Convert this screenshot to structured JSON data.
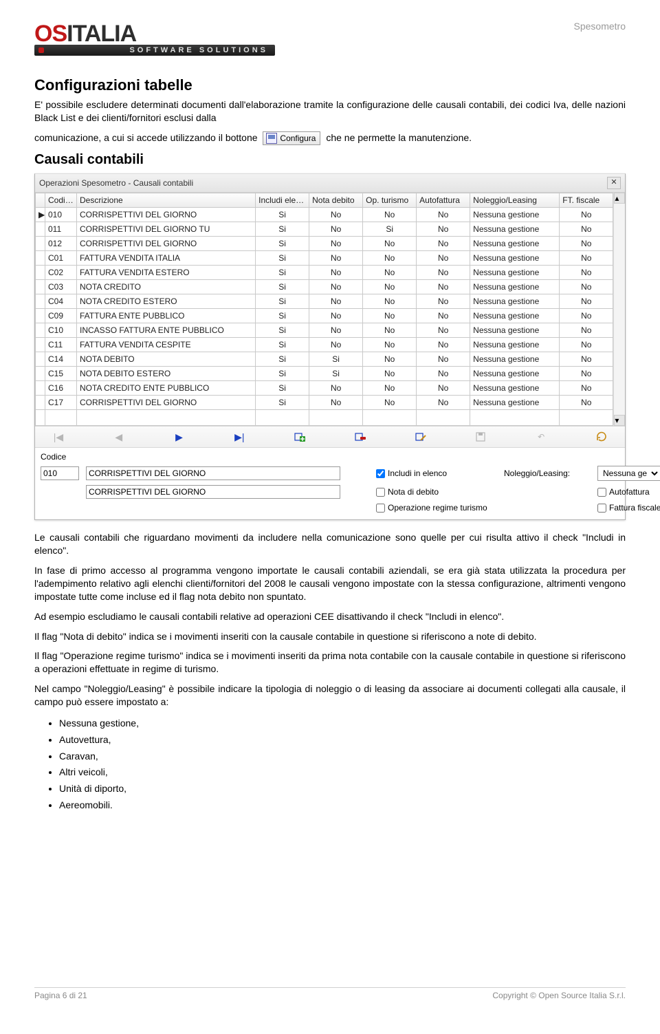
{
  "header": {
    "topRight": "Spesometro",
    "logoMainA": "OS",
    "logoMainB": "ITALIA",
    "logoSub": "SOFTWARE SOLUTIONS"
  },
  "section": {
    "title": "Configurazioni tabelle",
    "introA": "E' possibile escludere determinati documenti dall'elaborazione tramite la configurazione delle causali contabili, dei codici Iva, delle nazioni Black List e dei clienti/fornitori esclusi dalla",
    "introB_pre": "comunicazione, a cui si accede utilizzando il bottone ",
    "btnConfig": "Configura",
    "introB_post": " che ne permette la manutenzione.",
    "subTitle": "Causali contabili"
  },
  "window": {
    "title": "Operazioni Spesometro - Causali contabili",
    "columns": [
      "",
      "Codice",
      "Descrizione",
      "Includi elenco",
      "Nota debito",
      "Op. turismo",
      "Autofattura",
      "Noleggio/Leasing",
      "FT. fiscale"
    ],
    "rows": [
      {
        "mark": "▶",
        "c": "010",
        "d": "CORRISPETTIVI DEL GIORNO",
        "ie": "Si",
        "nd": "No",
        "ot": "No",
        "af": "No",
        "nl": "Nessuna gestione",
        "ff": "No"
      },
      {
        "mark": "",
        "c": "011",
        "d": "CORRISPETTIVI DEL GIORNO TU",
        "ie": "Si",
        "nd": "No",
        "ot": "Si",
        "af": "No",
        "nl": "Nessuna gestione",
        "ff": "No"
      },
      {
        "mark": "",
        "c": "012",
        "d": "CORRISPETTIVI DEL GIORNO",
        "ie": "Si",
        "nd": "No",
        "ot": "No",
        "af": "No",
        "nl": "Nessuna gestione",
        "ff": "No"
      },
      {
        "mark": "",
        "c": "C01",
        "d": "FATTURA VENDITA ITALIA",
        "ie": "Si",
        "nd": "No",
        "ot": "No",
        "af": "No",
        "nl": "Nessuna gestione",
        "ff": "No"
      },
      {
        "mark": "",
        "c": "C02",
        "d": "FATTURA VENDITA ESTERO",
        "ie": "Si",
        "nd": "No",
        "ot": "No",
        "af": "No",
        "nl": "Nessuna gestione",
        "ff": "No"
      },
      {
        "mark": "",
        "c": "C03",
        "d": "NOTA CREDITO",
        "ie": "Si",
        "nd": "No",
        "ot": "No",
        "af": "No",
        "nl": "Nessuna gestione",
        "ff": "No"
      },
      {
        "mark": "",
        "c": "C04",
        "d": "NOTA CREDITO ESTERO",
        "ie": "Si",
        "nd": "No",
        "ot": "No",
        "af": "No",
        "nl": "Nessuna gestione",
        "ff": "No"
      },
      {
        "mark": "",
        "c": "C09",
        "d": "FATTURA ENTE PUBBLICO",
        "ie": "Si",
        "nd": "No",
        "ot": "No",
        "af": "No",
        "nl": "Nessuna gestione",
        "ff": "No"
      },
      {
        "mark": "",
        "c": "C10",
        "d": "INCASSO FATTURA ENTE PUBBLICO",
        "ie": "Si",
        "nd": "No",
        "ot": "No",
        "af": "No",
        "nl": "Nessuna gestione",
        "ff": "No"
      },
      {
        "mark": "",
        "c": "C11",
        "d": "FATTURA VENDITA CESPITE",
        "ie": "Si",
        "nd": "No",
        "ot": "No",
        "af": "No",
        "nl": "Nessuna gestione",
        "ff": "No"
      },
      {
        "mark": "",
        "c": "C14",
        "d": "NOTA DEBITO",
        "ie": "Si",
        "nd": "Si",
        "ot": "No",
        "af": "No",
        "nl": "Nessuna gestione",
        "ff": "No"
      },
      {
        "mark": "",
        "c": "C15",
        "d": "NOTA DEBITO ESTERO",
        "ie": "Si",
        "nd": "Si",
        "ot": "No",
        "af": "No",
        "nl": "Nessuna gestione",
        "ff": "No"
      },
      {
        "mark": "",
        "c": "C16",
        "d": "NOTA CREDITO ENTE PUBBLICO",
        "ie": "Si",
        "nd": "No",
        "ot": "No",
        "af": "No",
        "nl": "Nessuna gestione",
        "ff": "No"
      },
      {
        "mark": "",
        "c": "C17",
        "d": "CORRISPETTIVI DEL GIORNO",
        "ie": "Si",
        "nd": "No",
        "ot": "No",
        "af": "No",
        "nl": "Nessuna gestione",
        "ff": "No"
      }
    ],
    "form": {
      "labelCode": "Codice",
      "code": "010",
      "desc1": "CORRISPETTIVI DEL GIORNO",
      "desc2": "CORRISPETTIVI DEL GIORNO",
      "chkIncludi": "Includi in elenco",
      "labelNL": "Noleggio/Leasing:",
      "nlValue": "Nessuna gestione",
      "chkNota": "Nota di debito",
      "chkAuto": "Autofattura",
      "chkTurismo": "Operazione regime turismo",
      "chkFiscale": "Fattura fiscale"
    }
  },
  "text": {
    "p1": "Le causali contabili che riguardano movimenti da includere nella comunicazione sono quelle per cui risulta attivo il check \"Includi in elenco\".",
    "p2": "In fase di primo accesso al programma vengono importate le causali contabili aziendali, se era già stata utilizzata la procedura per l'adempimento relativo agli elenchi clienti/fornitori del 2008 le causali vengono impostate con la stessa configurazione, altrimenti vengono impostate tutte come incluse ed il flag nota debito non spuntato.",
    "p3": "Ad esempio escludiamo le causali contabili relative ad operazioni CEE disattivando il check \"Includi in elenco\".",
    "p4": "Il flag \"Nota di debito\" indica se i movimenti inseriti con la causale contabile in questione si riferiscono a note di debito.",
    "p5": "Il flag \"Operazione regime turismo\" indica se i movimenti inseriti da prima nota contabile con la causale contabile in questione si riferiscono a operazioni effettuate in regime di turismo.",
    "p6": "Nel campo \"Noleggio/Leasing\" è possibile indicare la tipologia di noleggio o di leasing da associare ai documenti collegati alla causale, il campo può essere impostato a:",
    "list": [
      "Nessuna gestione,",
      "Autovettura,",
      "Caravan,",
      "Altri veicoli,",
      "Unità di diporto,",
      "Aereomobili."
    ]
  },
  "footer": {
    "left": "Pagina 6 di 21",
    "right": "Copyright © Open Source Italia S.r.l."
  }
}
